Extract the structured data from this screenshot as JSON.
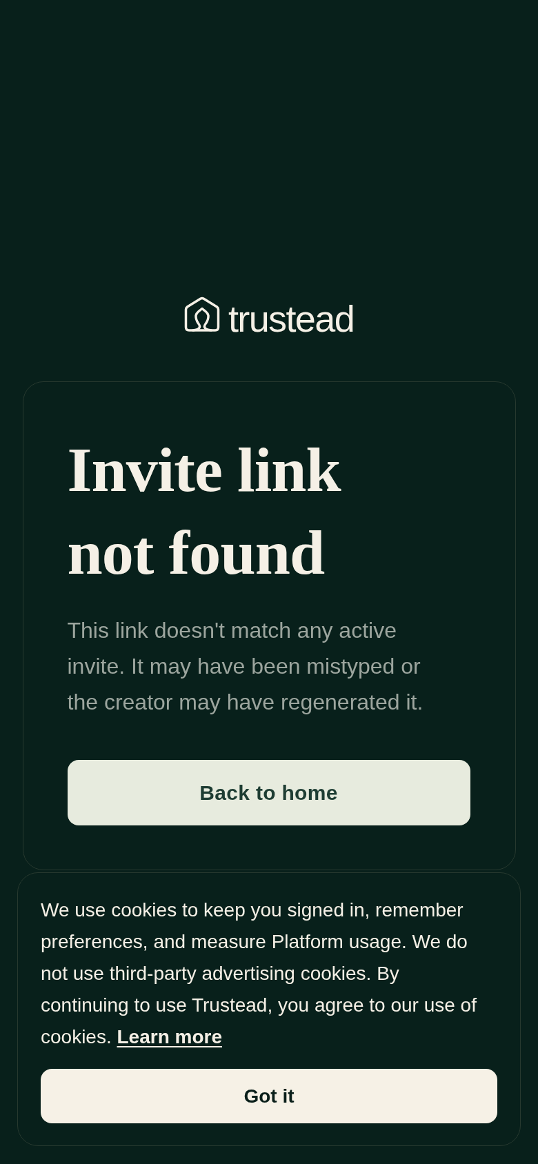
{
  "logo": {
    "wordmark": "trustead"
  },
  "card": {
    "title": "Invite link not found",
    "message": "This link doesn't match any active invite. It may have been mistyped or the creator may have regenerated it.",
    "button": "Back to home"
  },
  "cookie_banner": {
    "message": "We use cookies to keep you signed in, remember preferences, and measure Platform usage. We do not use third-party advertising cookies. By continuing to use Trustead, you agree to our use of cookies.",
    "link": "Learn more",
    "button": "Got it"
  }
}
